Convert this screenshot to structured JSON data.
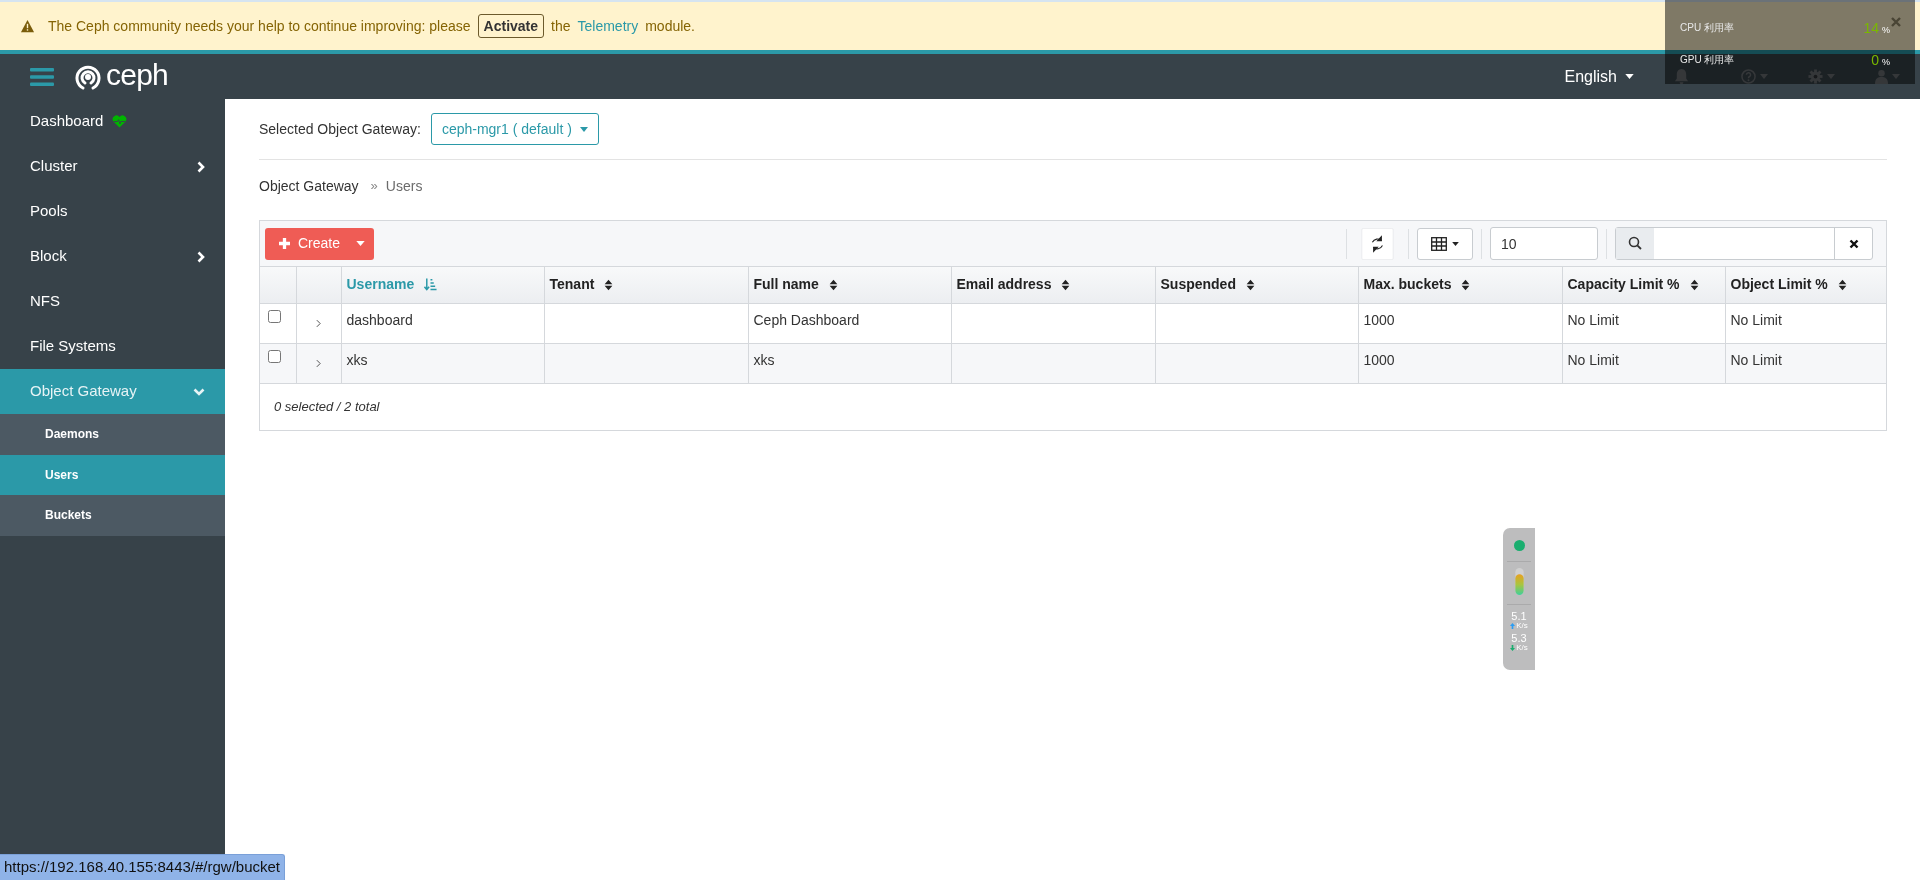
{
  "banner": {
    "text_before": "The Ceph community needs your help to continue improving: please",
    "button": "Activate",
    "text_middle": "the",
    "link": "Telemetry",
    "text_after": "module."
  },
  "header": {
    "brand": "ceph",
    "language": "English"
  },
  "sidebar": {
    "items": [
      {
        "label": "Dashboard",
        "selected": false
      },
      {
        "label": "Cluster",
        "selected": false,
        "expanded": false
      },
      {
        "label": "Pools",
        "selected": false
      },
      {
        "label": "Block",
        "selected": false,
        "expanded": false
      },
      {
        "label": "NFS",
        "selected": false
      },
      {
        "label": "File Systems",
        "selected": false
      },
      {
        "label": "Object Gateway",
        "selected": true,
        "expanded": true,
        "children": [
          {
            "label": "Daemons",
            "selected": false
          },
          {
            "label": "Users",
            "selected": true
          },
          {
            "label": "Buckets",
            "selected": false
          }
        ]
      }
    ]
  },
  "gateway_selector": {
    "label": "Selected Object Gateway:",
    "value": "ceph-mgr1 ( default )"
  },
  "breadcrumb": {
    "separator": "»",
    "items": [
      "Object Gateway",
      "Users"
    ]
  },
  "toolbar": {
    "create_button": "Create",
    "page_size": "10"
  },
  "table": {
    "columns": [
      {
        "label": "Username",
        "sorted": true
      },
      {
        "label": "Tenant",
        "sorted": false
      },
      {
        "label": "Full name",
        "sorted": false
      },
      {
        "label": "Email address",
        "sorted": false
      },
      {
        "label": "Suspended",
        "sorted": false
      },
      {
        "label": "Max. buckets",
        "sorted": false
      },
      {
        "label": "Capacity Limit %",
        "sorted": false
      },
      {
        "label": "Object Limit %",
        "sorted": false
      }
    ],
    "rows": [
      {
        "checked": false,
        "cells": [
          "dashboard",
          "",
          "Ceph Dashboard",
          "",
          "",
          "1000",
          "No Limit",
          "No Limit"
        ]
      },
      {
        "checked": false,
        "cells": [
          "xks",
          "",
          "xks",
          "",
          "",
          "1000",
          "No Limit",
          "No Limit"
        ]
      }
    ],
    "footer": "0 selected / 2 total"
  },
  "monitor_overlay": {
    "rows": [
      {
        "label": "CPU 利用率",
        "value": "14",
        "unit": "%"
      },
      {
        "label": "GPU 利用率",
        "value": "0",
        "unit": "%"
      }
    ]
  },
  "speed_widget": {
    "rates": [
      {
        "kind": "up",
        "value": "5.1",
        "unit": "K/s"
      },
      {
        "kind": "down",
        "value": "5.3",
        "unit": "K/s"
      }
    ]
  },
  "status_bar": {
    "url": "https://192.168.40.155:8443/#/rgw/bucket"
  }
}
